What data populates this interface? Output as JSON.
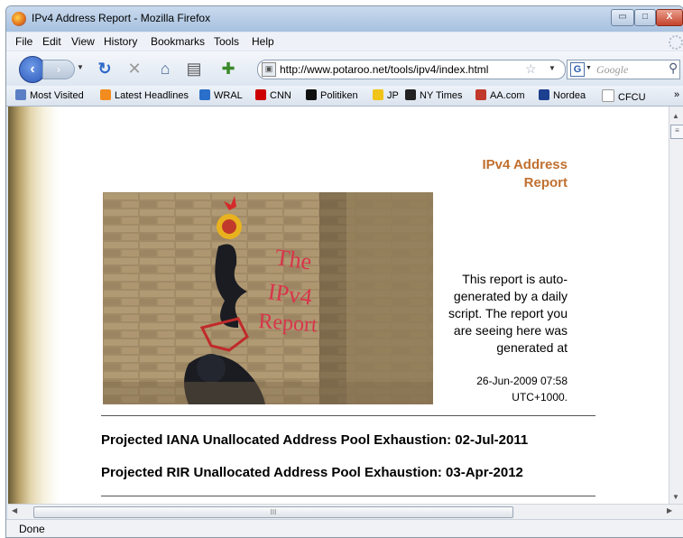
{
  "window": {
    "title": "IPv4 Address Report - Mozilla Firefox",
    "min_glyph": "▭",
    "max_glyph": "□",
    "close_glyph": "X"
  },
  "menu": {
    "items": [
      {
        "label": "File",
        "mnemonic": "F"
      },
      {
        "label": "Edit",
        "mnemonic": "E"
      },
      {
        "label": "View",
        "mnemonic": "V"
      },
      {
        "label": "History",
        "mnemonic": "s"
      },
      {
        "label": "Bookmarks",
        "mnemonic": "B"
      },
      {
        "label": "Tools",
        "mnemonic": "T"
      },
      {
        "label": "Help",
        "mnemonic": "H"
      }
    ]
  },
  "navbar": {
    "url": "http://www.potaroo.net/tools/ipv4/index.html",
    "search_placeholder": "Google",
    "search_engine_letter": "G"
  },
  "bookmarks": {
    "items": [
      {
        "label": "Most Visited",
        "icon": "most-visited-icon",
        "color": "#5b7fc4"
      },
      {
        "label": "Latest Headlines",
        "icon": "rss-icon",
        "color": "#f28c1e"
      },
      {
        "label": "WRAL",
        "icon": "wral-icon",
        "color": "#2a6fc9"
      },
      {
        "label": "CNN",
        "icon": "cnn-icon",
        "color": "#cc0000"
      },
      {
        "label": "Politiken",
        "icon": "politiken-icon",
        "color": "#111111"
      },
      {
        "label": "JP",
        "icon": "jp-icon",
        "color": "#f0c419"
      },
      {
        "label": "NY Times",
        "icon": "nytimes-icon",
        "color": "#222222"
      },
      {
        "label": "AA.com",
        "icon": "aa-icon",
        "color": "#c0392b"
      },
      {
        "label": "Nordea",
        "icon": "nordea-icon",
        "color": "#1d3f8f"
      },
      {
        "label": "CFCU",
        "icon": "page-icon",
        "color": "#dfe5ec"
      }
    ],
    "more": "»"
  },
  "report": {
    "title": "IPv4 Address Report",
    "title_color": "#c07030",
    "photo_caption": "The IPv4 Report",
    "description": "This report is auto-generated by a daily script. The report you are seeing here was generated at",
    "generated_date": "26-Jun-2009 07:58",
    "generated_tz": "UTC+1000.",
    "iana_line": "Projected IANA Unallocated Address Pool Exhaustion: 02-Jul-2011",
    "rir_line": "Projected RIR Unallocated Address Pool Exhaustion: 03-Apr-2012"
  },
  "scroll": {
    "thumb_grip": "III"
  },
  "status": {
    "text": "Done"
  }
}
